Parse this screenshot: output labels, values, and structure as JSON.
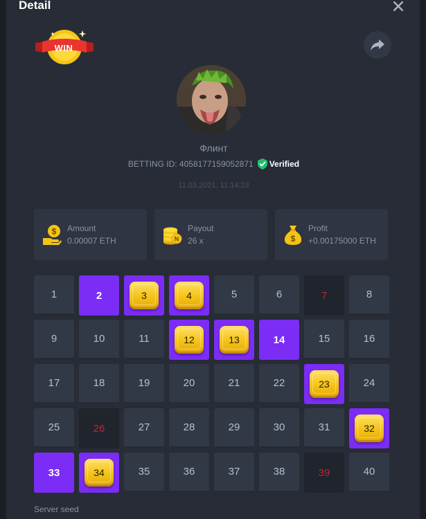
{
  "modal": {
    "title": "Detail",
    "close_icon": "close-icon",
    "badge": {
      "text": "WIN"
    },
    "share_icon": "share-icon"
  },
  "user": {
    "name": "Флинт",
    "betting_id_label": "BETTING ID: 4058177159052871",
    "verified_label": "Verified"
  },
  "timestamp": "11.03.2021, 11:14:23",
  "stats": [
    {
      "label": "Amount",
      "value": "0.00007 ETH",
      "icon": "coin-hand-icon"
    },
    {
      "label": "Payout",
      "value": "26 x",
      "icon": "coin-stack-icon"
    },
    {
      "label": "Profit",
      "value": "+0.00175000 ETH",
      "icon": "money-bag-icon"
    }
  ],
  "grid": {
    "rows": 5,
    "cols": 8,
    "cells": [
      {
        "n": "1",
        "state": "plain"
      },
      {
        "n": "2",
        "state": "picked"
      },
      {
        "n": "3",
        "state": "win"
      },
      {
        "n": "4",
        "state": "win"
      },
      {
        "n": "5",
        "state": "plain"
      },
      {
        "n": "6",
        "state": "plain"
      },
      {
        "n": "7",
        "state": "drawn"
      },
      {
        "n": "8",
        "state": "plain"
      },
      {
        "n": "9",
        "state": "plain"
      },
      {
        "n": "10",
        "state": "plain"
      },
      {
        "n": "11",
        "state": "plain"
      },
      {
        "n": "12",
        "state": "win"
      },
      {
        "n": "13",
        "state": "win"
      },
      {
        "n": "14",
        "state": "picked"
      },
      {
        "n": "15",
        "state": "plain"
      },
      {
        "n": "16",
        "state": "plain"
      },
      {
        "n": "17",
        "state": "plain"
      },
      {
        "n": "18",
        "state": "plain"
      },
      {
        "n": "19",
        "state": "plain"
      },
      {
        "n": "20",
        "state": "plain"
      },
      {
        "n": "21",
        "state": "plain"
      },
      {
        "n": "22",
        "state": "plain"
      },
      {
        "n": "23",
        "state": "win"
      },
      {
        "n": "24",
        "state": "plain"
      },
      {
        "n": "25",
        "state": "plain"
      },
      {
        "n": "26",
        "state": "drawn"
      },
      {
        "n": "27",
        "state": "plain"
      },
      {
        "n": "28",
        "state": "plain"
      },
      {
        "n": "29",
        "state": "plain"
      },
      {
        "n": "30",
        "state": "plain"
      },
      {
        "n": "31",
        "state": "plain"
      },
      {
        "n": "32",
        "state": "win"
      },
      {
        "n": "33",
        "state": "picked"
      },
      {
        "n": "34",
        "state": "win"
      },
      {
        "n": "35",
        "state": "plain"
      },
      {
        "n": "36",
        "state": "plain"
      },
      {
        "n": "37",
        "state": "plain"
      },
      {
        "n": "38",
        "state": "plain"
      },
      {
        "n": "39",
        "state": "drawn"
      },
      {
        "n": "40",
        "state": "plain"
      }
    ]
  },
  "server_seed_label": "Server seed",
  "colors": {
    "background": "#272c36",
    "card": "#2f3542",
    "picked": "#7b2cf5",
    "drawn_text": "#c0272d",
    "gem": "#f5c316",
    "verified": "#1fc16b"
  }
}
